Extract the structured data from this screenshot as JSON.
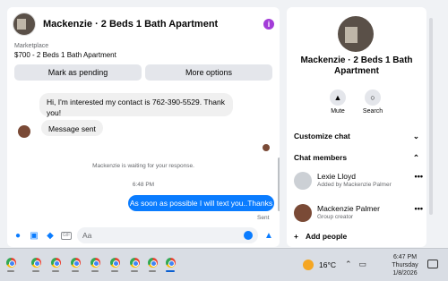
{
  "chat": {
    "title": "Mackenzie · 2 Beds 1 Bath Apartment",
    "marketplace_label": "Marketplace",
    "price_line": "$700 - 2 Beds 1 Bath Apartment",
    "pending_button": "Mark as pending",
    "more_options_button": "More options",
    "messages": {
      "incoming_1": "Hi, I'm interested my contact is 762-390-5529. Thank you!",
      "incoming_2": "Message sent",
      "waiting_note": "Mackenzie is waiting for your response.",
      "timestamp": "6:48 PM",
      "outgoing_1": "As soon as possible I will text you..Thanks",
      "status": "Sent"
    },
    "composer_placeholder": "Aa"
  },
  "details": {
    "title": "Mackenzie · 2 Beds 1 Bath Apartment",
    "mute_label": "Mute",
    "search_label": "Search",
    "customize_label": "Customize chat",
    "members_label": "Chat members",
    "members": [
      {
        "name": "Lexie Lloyd",
        "sub": "Added by Mackenzie Palmer"
      },
      {
        "name": "Mackenzie Palmer",
        "sub": "Group creator"
      }
    ],
    "add_people_label": "Add people"
  },
  "taskbar": {
    "temperature": "16°C",
    "time": "6:47 PM",
    "day": "Thursday",
    "date": "1/8/2026"
  },
  "colors": {
    "accent": "#0a7cff",
    "info": "#a33cd8"
  }
}
